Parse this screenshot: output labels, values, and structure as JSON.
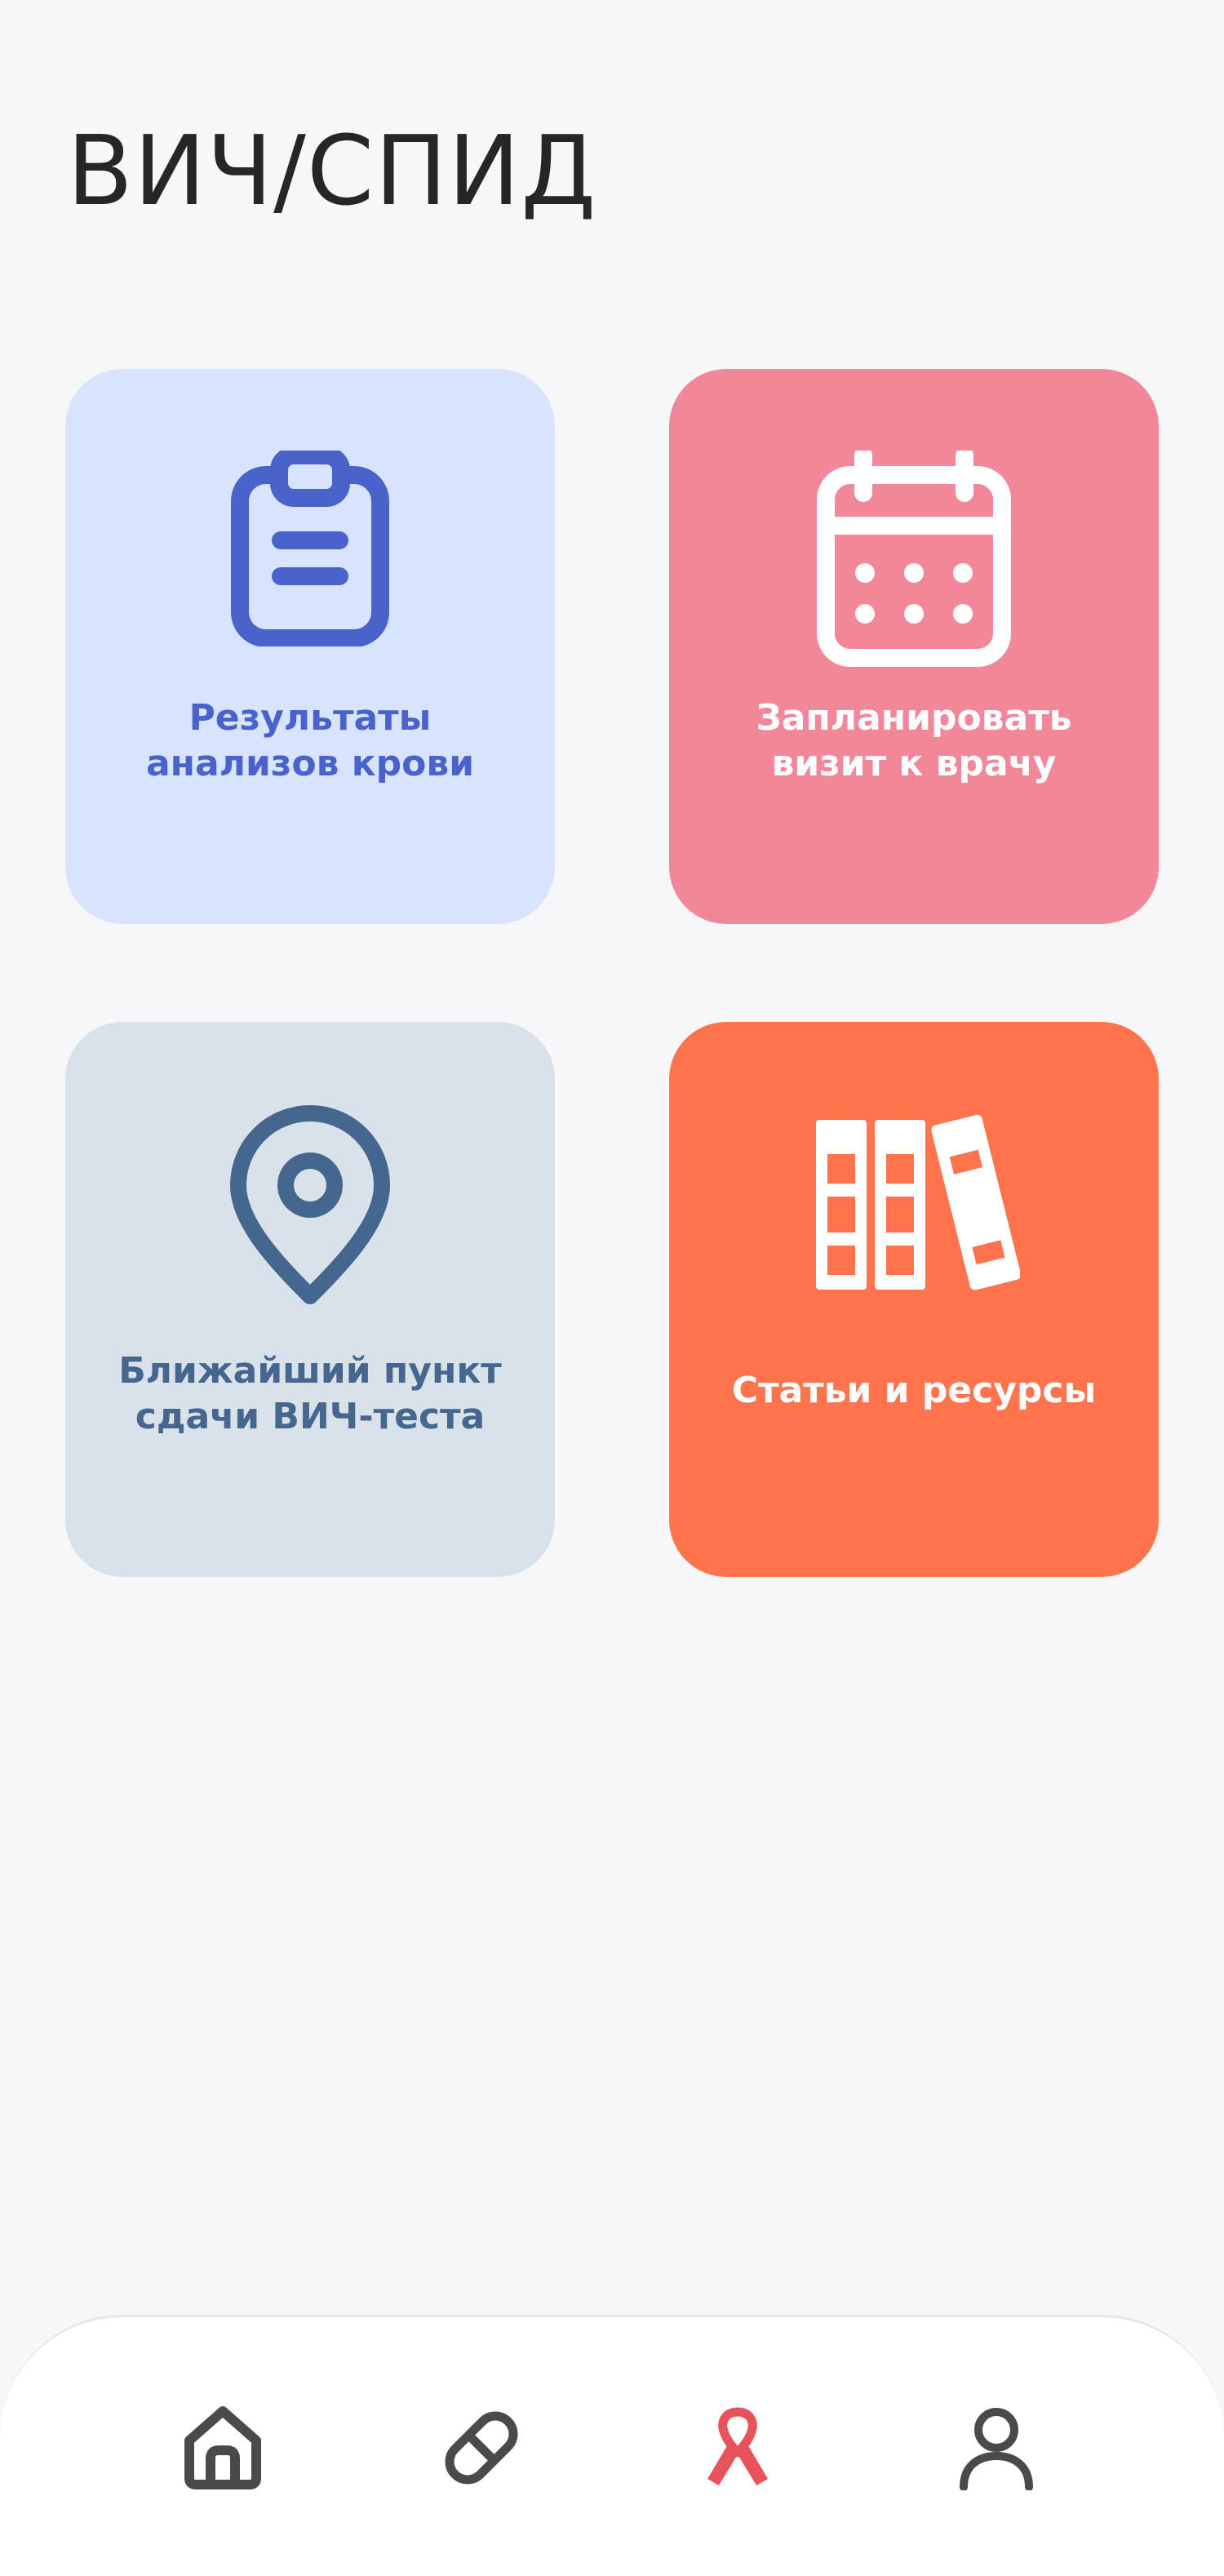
{
  "header": {
    "title": "ВИЧ/СПИД"
  },
  "tiles": [
    {
      "label": "Результаты анализов крови",
      "icon": "clipboard-icon",
      "background": "#d8e4fd",
      "accent": "#4a63cc"
    },
    {
      "label": "Запланировать визит к врачу",
      "icon": "calendar-icon",
      "background": "#f28799",
      "accent": "#ffffff"
    },
    {
      "label": "Ближайший пункт сдачи ВИЧ-теста",
      "icon": "map-pin-icon",
      "background": "#dae2e9",
      "accent": "#44668f"
    },
    {
      "label": "Статьи и ресурсы",
      "icon": "books-icon",
      "background": "#ff734d",
      "accent": "#ffffff"
    }
  ],
  "bottom_nav": {
    "items": [
      {
        "icon": "home-icon",
        "active": false
      },
      {
        "icon": "pill-icon",
        "active": false
      },
      {
        "icon": "ribbon-icon",
        "active": true
      },
      {
        "icon": "profile-icon",
        "active": false
      }
    ],
    "active_color": "#e8525b",
    "inactive_color": "#4a4a4a"
  }
}
